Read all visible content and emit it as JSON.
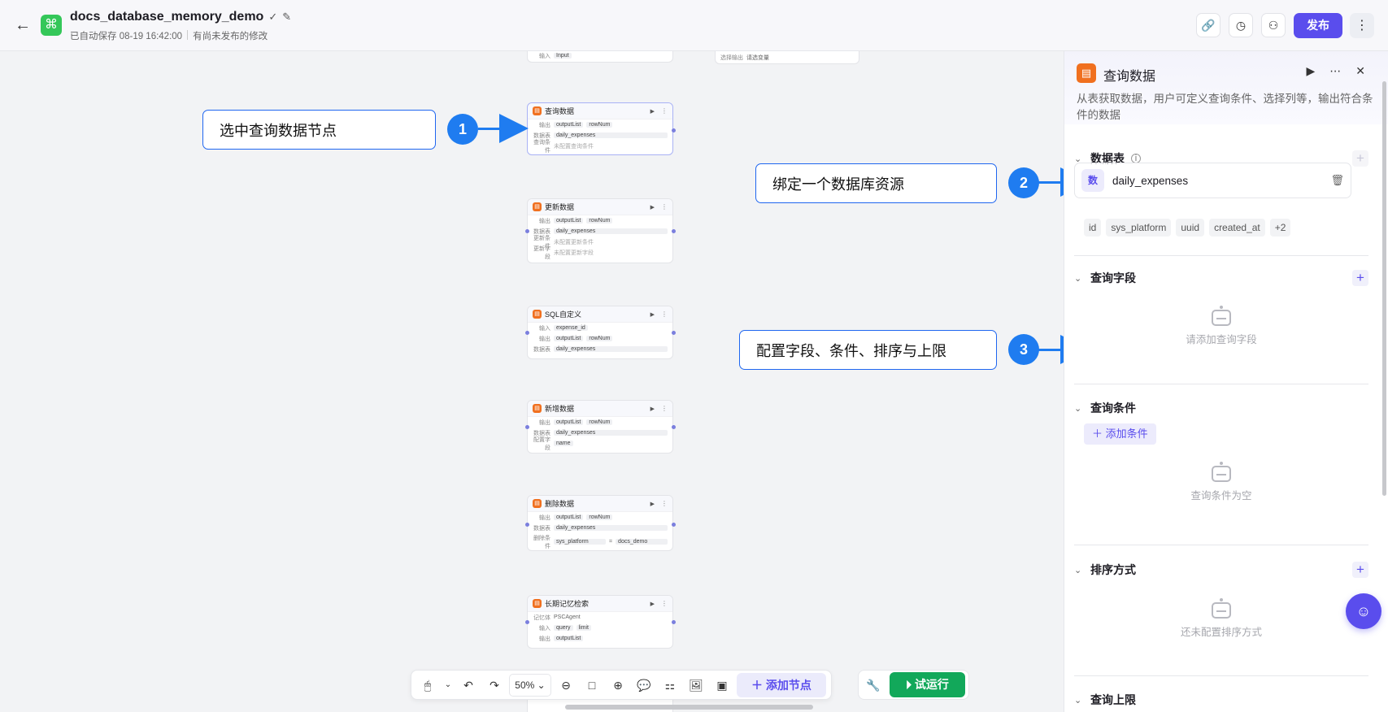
{
  "header": {
    "back_icon": "arrow-left-icon",
    "title": "docs_database_memory_demo",
    "autosave": "已自动保存 08-19 16:42:00",
    "unpublished": "有尚未发布的修改",
    "publish_label": "发布"
  },
  "canvas": {
    "top_node": {
      "row_label": "输入",
      "row_value": "Input"
    },
    "top_right_node": {
      "row_label": "选择输出",
      "row_value": "请选变量"
    },
    "nodes": [
      {
        "title": "查询数据",
        "rows": [
          {
            "k": "输出",
            "chips": [
              "outputList",
              "rowNum"
            ]
          },
          {
            "k": "数据表",
            "bar": "daily_expenses"
          },
          {
            "k": "查询条件",
            "text": "未配置查询条件"
          }
        ]
      },
      {
        "title": "更新数据",
        "rows": [
          {
            "k": "输出",
            "chips": [
              "outputList",
              "rowNum"
            ]
          },
          {
            "k": "数据表",
            "bar": "daily_expenses"
          },
          {
            "k": "更新条件",
            "text": "未配置更新条件"
          },
          {
            "k": "更新字段",
            "text": "未配置更新字段"
          }
        ]
      },
      {
        "title": "SQL自定义",
        "rows": [
          {
            "k": "输入",
            "chips": [
              "expense_id"
            ]
          },
          {
            "k": "输出",
            "chips": [
              "outputList",
              "rowNum"
            ]
          },
          {
            "k": "数据表",
            "bar": "daily_expenses"
          }
        ]
      },
      {
        "title": "新增数据",
        "rows": [
          {
            "k": "输出",
            "chips": [
              "outputList",
              "rowNum"
            ]
          },
          {
            "k": "数据表",
            "bar": "daily_expenses"
          },
          {
            "k": "配置字段",
            "chips": [
              "name"
            ]
          }
        ]
      },
      {
        "title": "删除数据",
        "rows": [
          {
            "k": "输出",
            "chips": [
              "outputList",
              "rowNum"
            ]
          },
          {
            "k": "数据表",
            "bar": "daily_expenses"
          },
          {
            "k": "删除条件",
            "chips": [
              "sys_platform",
              "=",
              "docs_demo"
            ]
          }
        ]
      },
      {
        "title": "长期记忆检索",
        "rows": [
          {
            "k": "记忆体",
            "text": "PSCAgent"
          },
          {
            "k": "输入",
            "chips": [
              "query",
              "limit"
            ]
          },
          {
            "k": "输出",
            "chips": [
              "outputList"
            ]
          }
        ]
      }
    ],
    "callouts": {
      "c1": "选中查询数据节点",
      "c2": "绑定一个数据库资源",
      "c3": "配置字段、条件、排序与上限"
    },
    "badges": [
      "1",
      "2",
      "3"
    ]
  },
  "toolbar": {
    "zoom": "50%",
    "add_node": "添加节点",
    "run": "试运行"
  },
  "panel": {
    "title": "查询数据",
    "description": "从表获取数据，用户可定义查询条件、选择列等，输出符合条件的数据",
    "datatable": {
      "title": "数据表",
      "db_icon_text": "数",
      "db_name": "daily_expenses",
      "tags": [
        "id",
        "sys_platform",
        "uuid",
        "created_at",
        "+2"
      ]
    },
    "query_fields": {
      "title": "查询字段",
      "empty": "请添加查询字段"
    },
    "query_conditions": {
      "title": "查询条件",
      "add_label": "添加条件",
      "empty": "查询条件为空"
    },
    "sort": {
      "title": "排序方式",
      "empty": "还未配置排序方式"
    },
    "limit": {
      "title": "查询上限"
    }
  },
  "colors": {
    "brand": "#5a4ded",
    "callout": "#1f7cf0",
    "run": "#12a85a",
    "node_icon": "#f0701f"
  }
}
